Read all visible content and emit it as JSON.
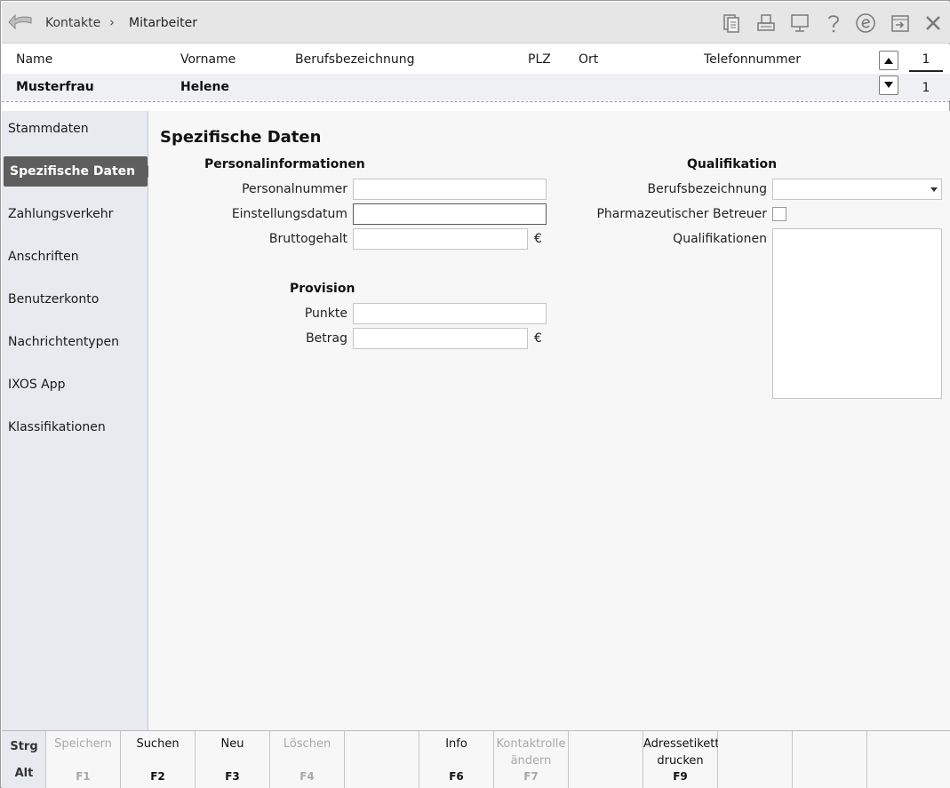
{
  "breadcrumb": {
    "root": "Kontakte",
    "separator": "›",
    "current": "Mitarbeiter"
  },
  "toolbar_icons": [
    "copy-icon",
    "print-icon",
    "monitor-icon",
    "help-icon",
    "e-icon",
    "exit-icon",
    "close-icon"
  ],
  "contact_header": {
    "columns": [
      "Name",
      "Vorname",
      "Berufsbezeichnung",
      "PLZ",
      "Ort",
      "Telefonnummer"
    ],
    "row": {
      "name": "Musterfrau",
      "vorname": "Helene"
    },
    "page_top": "1",
    "page_bottom": "1"
  },
  "sidebar": {
    "items": [
      {
        "label": "Stammdaten",
        "active": false
      },
      {
        "label": "Spezifische Daten",
        "active": true
      },
      {
        "label": "Zahlungsverkehr",
        "active": false
      },
      {
        "label": "Anschriften",
        "active": false
      },
      {
        "label": "Benutzerkonto",
        "active": false
      },
      {
        "label": "Nachrichtentypen",
        "active": false
      },
      {
        "label": "IXOS App",
        "active": false
      },
      {
        "label": "Klassifikationen",
        "active": false
      }
    ]
  },
  "main": {
    "title": "Spezifische Daten",
    "personal": {
      "heading": "Personalinformationen",
      "personalnummer_label": "Personalnummer",
      "personalnummer_value": "",
      "einstellungsdatum_label": "Einstellungsdatum",
      "einstellungsdatum_value": "",
      "bruttogehalt_label": "Bruttogehalt",
      "bruttogehalt_value": "",
      "currency": "€"
    },
    "provision": {
      "heading": "Provision",
      "punkte_label": "Punkte",
      "punkte_value": "",
      "betrag_label": "Betrag",
      "betrag_value": "",
      "currency": "€"
    },
    "qualifikation": {
      "heading": "Qualifikation",
      "berufsbezeichnung_label": "Berufsbezeichnung",
      "berufsbezeichnung_value": "",
      "pharma_label": "Pharmazeutischer Betreuer",
      "pharma_checked": false,
      "qualifikationen_label": "Qualifikationen"
    }
  },
  "function_bar": {
    "modifiers": [
      "Strg",
      "Alt"
    ],
    "keys": [
      {
        "label": "Speichern",
        "key": "F1",
        "disabled": true
      },
      {
        "label": "Suchen",
        "key": "F2",
        "disabled": false
      },
      {
        "label": "Neu",
        "key": "F3",
        "disabled": false
      },
      {
        "label": "Löschen",
        "key": "F4",
        "disabled": true
      },
      {
        "label": "",
        "key": "",
        "disabled": false
      },
      {
        "label": "Info",
        "key": "F6",
        "disabled": false
      },
      {
        "label": "Kontaktrolle ändern",
        "key": "F7",
        "disabled": true
      },
      {
        "label": "",
        "key": "",
        "disabled": false
      },
      {
        "label": "Adressetikett drucken",
        "key": "F9",
        "disabled": false
      },
      {
        "label": "",
        "key": "",
        "disabled": false
      },
      {
        "label": "",
        "key": "",
        "disabled": false
      },
      {
        "label": "",
        "key": "",
        "disabled": false
      }
    ]
  }
}
